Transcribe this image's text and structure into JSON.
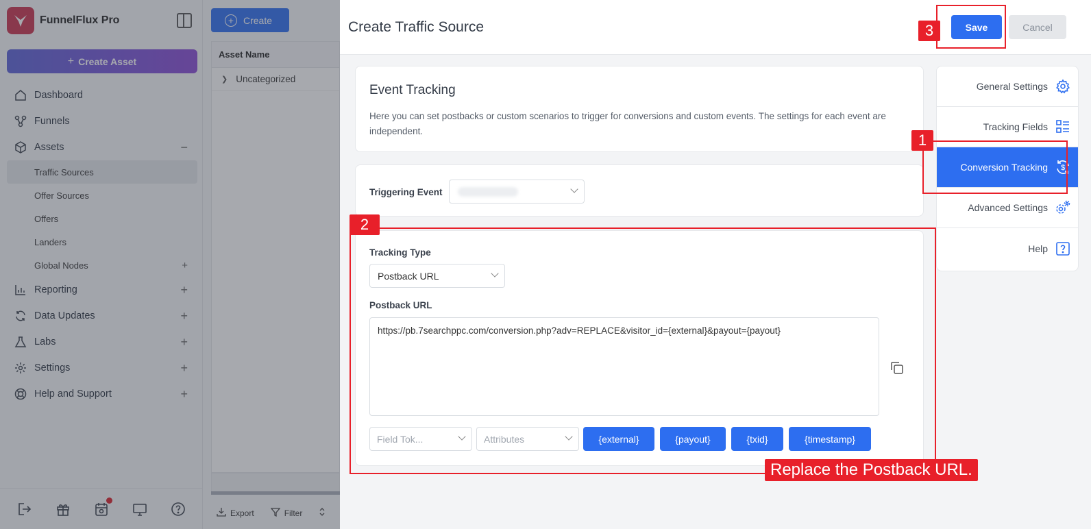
{
  "app": {
    "name": "FunnelFlux Pro"
  },
  "sidebar": {
    "create_asset_label": "Create Asset",
    "items": [
      {
        "label": "Dashboard",
        "icon": "home-icon",
        "trail": ""
      },
      {
        "label": "Funnels",
        "icon": "funnels-icon",
        "trail": ""
      },
      {
        "label": "Assets",
        "icon": "box-icon",
        "trail": "−"
      }
    ],
    "sub_items": [
      {
        "label": "Traffic Sources",
        "active": true,
        "trail": ""
      },
      {
        "label": "Offer Sources",
        "trail": ""
      },
      {
        "label": "Offers",
        "trail": ""
      },
      {
        "label": "Landers",
        "trail": ""
      },
      {
        "label": "Global Nodes",
        "trail": "+"
      }
    ],
    "items_after": [
      {
        "label": "Reporting",
        "icon": "chart-icon",
        "trail": "+"
      },
      {
        "label": "Data Updates",
        "icon": "refresh-icon",
        "trail": "+"
      },
      {
        "label": "Labs",
        "icon": "flask-icon",
        "trail": "+"
      },
      {
        "label": "Settings",
        "icon": "gear-icon",
        "trail": "+"
      },
      {
        "label": "Help and Support",
        "icon": "lifebuoy-icon",
        "trail": "+"
      }
    ]
  },
  "list": {
    "create_label": "Create",
    "column_header": "Asset Name",
    "rows": [
      "Uncategorized"
    ],
    "tools": {
      "export": "Export",
      "filter": "Filter"
    }
  },
  "modal": {
    "title": "Create Traffic Source",
    "save_label": "Save",
    "cancel_label": "Cancel",
    "event_tracking": {
      "heading": "Event Tracking",
      "description": "Here you can set postbacks or custom scenarios to trigger for conversions and custom events. The settings for each event are independent."
    },
    "triggering_event_label": "Triggering Event",
    "tracking_type_label": "Tracking Type",
    "tracking_type_value": "Postback URL",
    "postback_label": "Postback URL",
    "postback_value": "https://pb.7searchppc.com/conversion.php?adv=REPLACE&visitor_id={external}&payout={payout}",
    "field_tokens_placeholder": "Field Tok...",
    "attributes_placeholder": "Attributes",
    "tokens": [
      "{external}",
      "{payout}",
      "{txid}",
      "{timestamp}"
    ],
    "menu": [
      {
        "label": "General Settings",
        "icon": "gear-icon",
        "active": false
      },
      {
        "label": "Tracking Fields",
        "icon": "list-icon",
        "active": false
      },
      {
        "label": "Conversion Tracking",
        "icon": "dollar-refresh-icon",
        "active": true
      },
      {
        "label": "Advanced Settings",
        "icon": "gears-icon",
        "active": false
      },
      {
        "label": "Help",
        "icon": "question-icon",
        "active": false
      }
    ]
  },
  "annotations": {
    "step1": "1",
    "step2": "2",
    "step3": "3",
    "caption": "Replace the Postback URL."
  },
  "colors": {
    "accent": "#2d6ef0",
    "brand": "#c8324e",
    "annotation": "#e8202a"
  }
}
